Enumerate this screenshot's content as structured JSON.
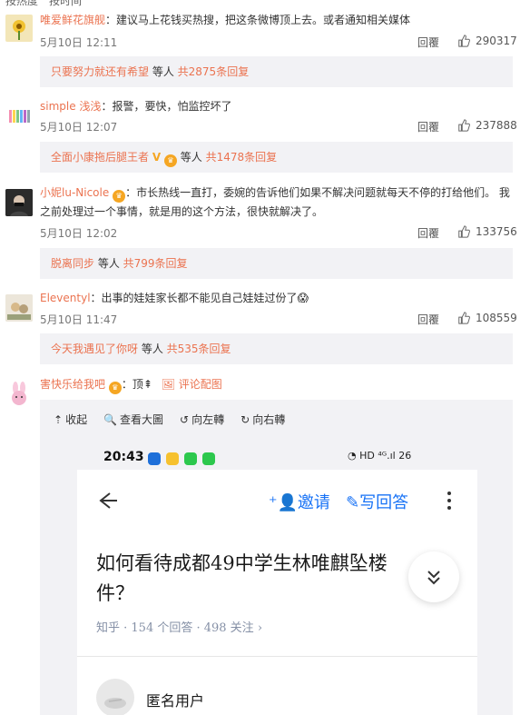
{
  "top_cut_text": "按热度　按时间",
  "comments": [
    {
      "user": "唯爱鲜花旗舰",
      "text": "：建议马上花钱买热搜，把这条微博顶上去。或者通知相关媒体",
      "time": "5月10日 12:11",
      "reply_label": "回覆",
      "likes": "290317",
      "sub_user": "只要努力就还有希望",
      "sub_mid": " 等人 ",
      "sub_count": "共2875条回复"
    },
    {
      "user": "simple 浅浅",
      "text": "：报警，要快，怕监控坏了",
      "time": "5月10日 12:07",
      "reply_label": "回覆",
      "likes": "237888",
      "sub_user": "全面小康拖后腿王者",
      "sub_mid": " 等人 ",
      "sub_count": "共1478条回复"
    },
    {
      "user": "小妮lu-Nicole",
      "text": "：市长热线一直打，委婉的告诉他们如果不解决问题就每天不停的打给他们。 我之前处理过一个事情，就是用的这个方法，很快就解决了。",
      "time": "5月10日 12:02",
      "reply_label": "回覆",
      "likes": "133756",
      "sub_user": "脱离同步",
      "sub_mid": " 等人 ",
      "sub_count": "共799条回复"
    },
    {
      "user": "Eleventyl",
      "text": "：出事的娃娃家长都不能见自己娃娃过份了😱",
      "time": "5月10日 11:47",
      "reply_label": "回覆",
      "likes": "108559",
      "sub_user": "今天我遇见了你呀",
      "sub_mid": " 等人 ",
      "sub_count": "共535条回复"
    }
  ],
  "last_comment": {
    "user": "害快乐给我吧",
    "text": "：顶⇞",
    "pic_label": "评论配图"
  },
  "image_toolbar": {
    "collapse": "收起",
    "view_large": "查看大圖",
    "rotate_left": "向左轉",
    "rotate_right": "向右轉"
  },
  "screenshot": {
    "time": "20:43",
    "status_right": "HD ⁴ᴳ.ıl 26",
    "invite": "邀请",
    "write_answer": "写回答",
    "question": "如何看待成都49中学生林唯麒坠楼件？",
    "meta": "知乎 · 154 个回答 · 498 关注 ›",
    "answerer": "匿名用户"
  },
  "colors": {
    "username": "#eb7350",
    "zhihu_blue": "#1772f6",
    "sub_box_bg": "#f2f2f5"
  }
}
